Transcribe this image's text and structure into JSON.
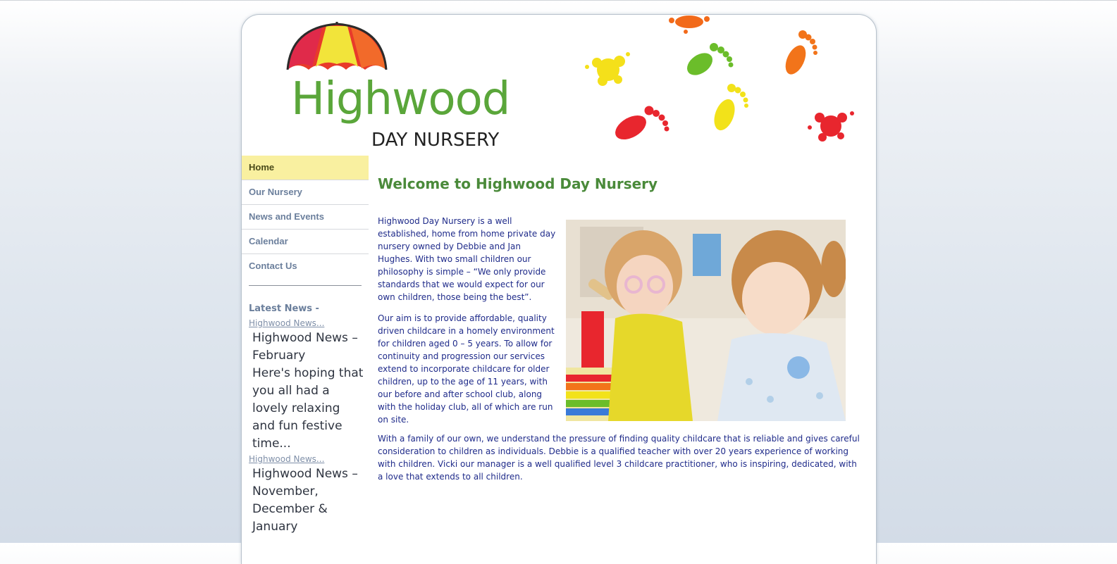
{
  "brand": {
    "name": "Highwood",
    "tagline": "DAY NURSERY"
  },
  "nav": {
    "items": [
      {
        "label": "Home",
        "active": true
      },
      {
        "label": "Our Nursery",
        "active": false
      },
      {
        "label": "News and Events",
        "active": false
      },
      {
        "label": "Calendar",
        "active": false
      },
      {
        "label": "Contact Us",
        "active": false
      }
    ]
  },
  "sidebar": {
    "news_heading": "Latest News -",
    "news": [
      {
        "link": "Highwood News...",
        "text": "Highwood News – February\n Here's hoping that you all had a lovely relaxing and fun festive time..."
      },
      {
        "link": "Highwood News...",
        "text": "Highwood News – November, December & January"
      }
    ]
  },
  "main": {
    "heading": "Welcome to Highwood Day Nursery",
    "para1": "Highwood Day Nursery is a well established, home from home private day nursery owned by Debbie and Jan Hughes. With two small children our philosophy is simple – “We only provide standards that we would expect for our own children, those being the best”.",
    "para2": "Our aim is to provide affordable, quality driven childcare in a homely environment for children aged 0 – 5 years. To allow for continuity and progression our services extend to incorporate childcare for older children, up to the age of 11 years, with our before and after school club, along with the holiday club, all of which are run on site.",
    "para3": "With a family of our own, we understand the pressure of finding quality childcare that is reliable and gives careful consideration to children as individuals. Debbie is a qualified teacher with over 20 years experience of working with children. Vicki our manager is a well qualified level 3 childcare practitioner, who is inspiring, dedicated, with a love that extends to all children."
  },
  "colors": {
    "accent_green": "#5aa63a",
    "nav_active_bg": "#f9f0a0",
    "body_text": "#1f2b8a"
  }
}
